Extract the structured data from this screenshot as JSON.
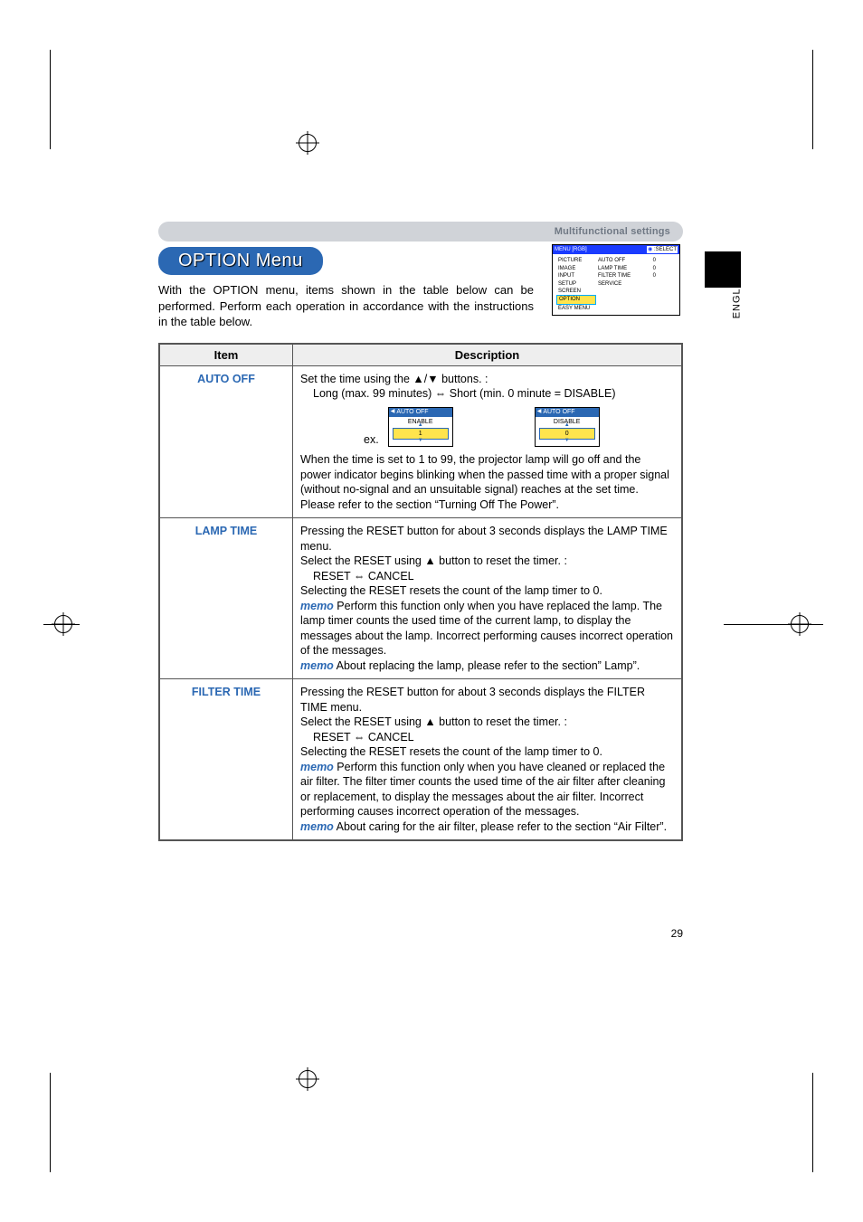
{
  "header": {
    "section_label": "Multifunctional settings"
  },
  "title_pill": "OPTION Menu",
  "intro": "With the OPTION menu, items shown in the table below can be performed. Perform each operation in accordance with the instructions in the table below.",
  "side_tab": "ENGLISH",
  "page_number": "29",
  "table": {
    "headers": {
      "item": "Item",
      "desc": "Description"
    },
    "rows": {
      "auto_off": {
        "label": "AUTO OFF",
        "line1": "Set the time using the ▲/▼ buttons. :",
        "line2": "Long (max. 99 minutes) ⇔ Short (min. 0 minute = DISABLE)",
        "ex_label": "ex.",
        "mini1": {
          "head": "AUTO OFF",
          "mid": "ENABLE",
          "val": "1"
        },
        "mini2": {
          "head": "AUTO OFF",
          "mid": "DISABLE",
          "val": "0"
        },
        "line3": "When the time is set to 1 to 99, the projector lamp will go off and the power indicator begins blinking when the passed time with a proper signal (without no-signal and an unsuitable signal) reaches at the set time. Please refer to the section “Turning Off The Power”."
      },
      "lamp_time": {
        "label": "LAMP TIME",
        "p1": "Pressing the RESET button for about 3 seconds displays the LAMP TIME menu.",
        "p2": "Select the RESET using ▲ button to reset the timer. :",
        "p3": "RESET ⇔ CANCEL",
        "p4": "Selecting the RESET resets the count of the lamp timer to 0.",
        "memo1_label": "memo",
        "memo1": " Perform this function only when you have replaced the lamp. The lamp timer counts the used time of the current lamp, to display the messages about the lamp. Incorrect performing causes incorrect operation of the messages.",
        "memo2_label": "memo",
        "memo2": " About replacing the lamp, please refer to the section” Lamp”."
      },
      "filter_time": {
        "label": "FILTER TIME",
        "p1": "Pressing the RESET button for about 3 seconds displays the FILTER TIME menu.",
        "p2": "Select the RESET using ▲ button to reset the timer. :",
        "p3": "RESET ⇔ CANCEL",
        "p4": "Selecting the RESET resets the count of the lamp timer to 0.",
        "memo1_label": "memo",
        "memo1": " Perform this function only when you have cleaned or replaced the air filter. The filter timer counts the used time of the air filter after cleaning or replacement, to display the messages about the air filter. Incorrect performing causes incorrect operation of the messages.",
        "memo2_label": "memo",
        "memo2": " About caring for the air filter, please refer to the section “Air Filter”."
      }
    }
  },
  "menu_panel": {
    "title_left": "MENU [RGB]",
    "title_right": ":SELECT",
    "left": [
      "PICTURE",
      "IMAGE",
      "INPUT",
      "SETUP",
      "SCREEN",
      "OPTION",
      "EASY MENU"
    ],
    "mid": [
      "AUTO OFF",
      "LAMP TIME",
      "FILTER TIME",
      "SERVICE"
    ],
    "right": [
      "0",
      "0",
      "0",
      ""
    ],
    "selected_index": 5
  }
}
